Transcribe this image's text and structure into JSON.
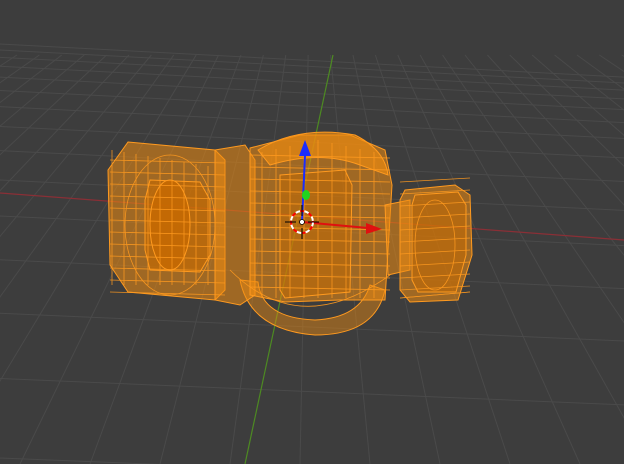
{
  "viewport": {
    "background": "#3d3d3d",
    "grid_color": "#4a4a4a",
    "x_axis_color": "#8a2f36",
    "y_axis_color": "#4d8a22"
  },
  "object": {
    "selected": true,
    "wire_color": "#ff9a1f",
    "face_color": "#f08c10",
    "shade_color": "#c86a00"
  },
  "gizmo": {
    "z_axis_color": "#1a2cff",
    "y_axis_color": "#1fd41f",
    "x_axis_color": "#e01010",
    "cursor_colors": [
      "#ff0000",
      "#ffffff"
    ],
    "icons": [
      "translate-z-arrow-icon",
      "translate-y-handle-icon",
      "translate-x-arrow-icon",
      "3d-cursor-icon"
    ]
  }
}
